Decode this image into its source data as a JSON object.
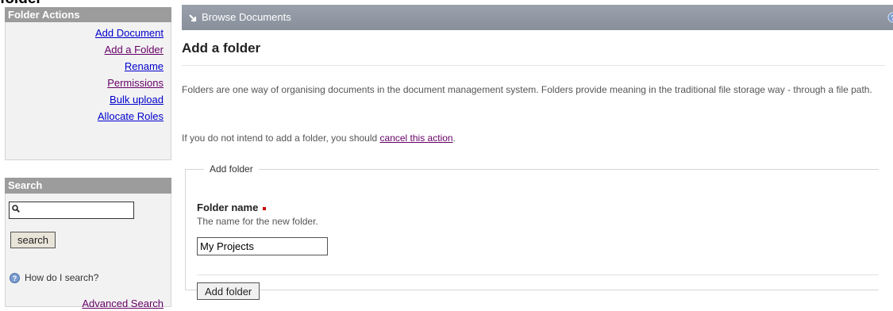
{
  "header_fragment": "folder",
  "sidebar": {
    "folder_actions": {
      "title": "Folder Actions",
      "items": [
        {
          "label": "Add Document"
        },
        {
          "label": "Add a Folder"
        },
        {
          "label": "Rename"
        },
        {
          "label": "Permissions"
        },
        {
          "label": "Bulk upload"
        },
        {
          "label": "Allocate Roles"
        }
      ]
    },
    "search": {
      "title": "Search",
      "input_value": "",
      "button_label": "search",
      "help_text": "How do I search?",
      "advanced_link": "Advanced Search"
    }
  },
  "browse_bar": {
    "label": "Browse Documents"
  },
  "main": {
    "title": "Add a folder",
    "intro": "Folders are one way of organising documents in the document management system. Folders provide meaning in the traditional file storage way - through a file path.",
    "cancel_prefix": "If you do not intend to add a folder, you should",
    "cancel_link": "cancel this action",
    "cancel_suffix": ".",
    "fieldset": {
      "legend": "Add folder",
      "field_label": "Folder name",
      "field_help": "The name for the new folder.",
      "field_value": "My Projects",
      "submit_label": "Add folder"
    }
  },
  "colors": {
    "panel_header": "#9c9c9c",
    "link_blue": "#0000cc",
    "link_visited": "#660066",
    "required": "#cc0000",
    "browse_bar": "#8f97a2"
  },
  "icons": {
    "search": "magnifier-icon",
    "help": "help-icon",
    "browse": "arrow-icon"
  }
}
